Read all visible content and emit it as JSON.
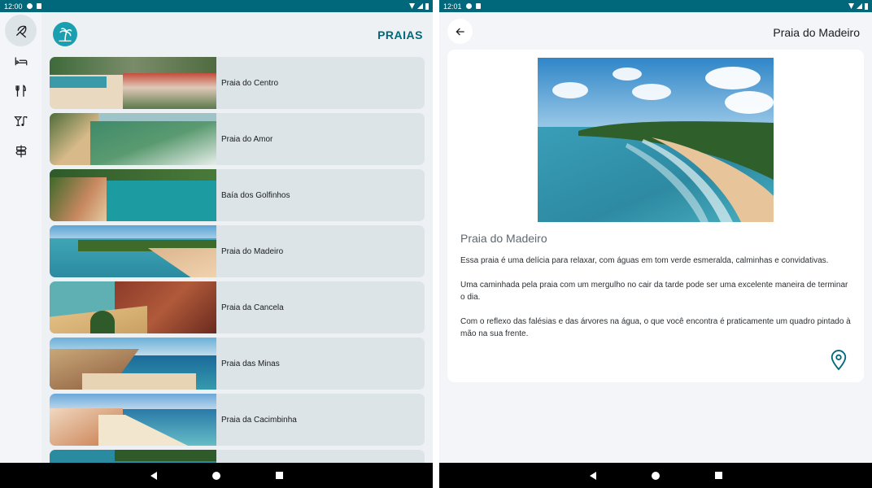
{
  "left": {
    "status_time": "12:00",
    "title": "PRAIAS",
    "rail": [
      {
        "icon": "beach-icon",
        "active": true
      },
      {
        "icon": "bed-icon",
        "active": false
      },
      {
        "icon": "restaurant-icon",
        "active": false
      },
      {
        "icon": "bar-music-icon",
        "active": false
      },
      {
        "icon": "signpost-icon",
        "active": false
      }
    ],
    "beaches": [
      {
        "name": "Praia do Centro"
      },
      {
        "name": "Praia do Amor"
      },
      {
        "name": "Baía dos Golfinhos"
      },
      {
        "name": "Praia do Madeiro"
      },
      {
        "name": "Praia da Cancela"
      },
      {
        "name": "Praia das Minas"
      },
      {
        "name": "Praia da Cacimbinha"
      },
      {
        "name": ""
      }
    ]
  },
  "right": {
    "status_time": "12:01",
    "title": "Praia do Madeiro",
    "heading": "Praia do Madeiro",
    "paragraphs": [
      "Essa praia é uma delícia para relaxar, com águas em tom verde esmeralda, calminhas e convidativas.",
      "Uma caminhada pela praia com um mergulho no cair da tarde pode ser uma excelente maneira de terminar o dia.",
      "Com o reflexo das falésias e das árvores na água, o que você encontra é praticamente um quadro pintado à mão na sua frente."
    ]
  },
  "colors": {
    "primary": "#00687a",
    "status_bar": "#00687a",
    "card_bg": "#dde4e8",
    "nav_bar": "#000000"
  }
}
